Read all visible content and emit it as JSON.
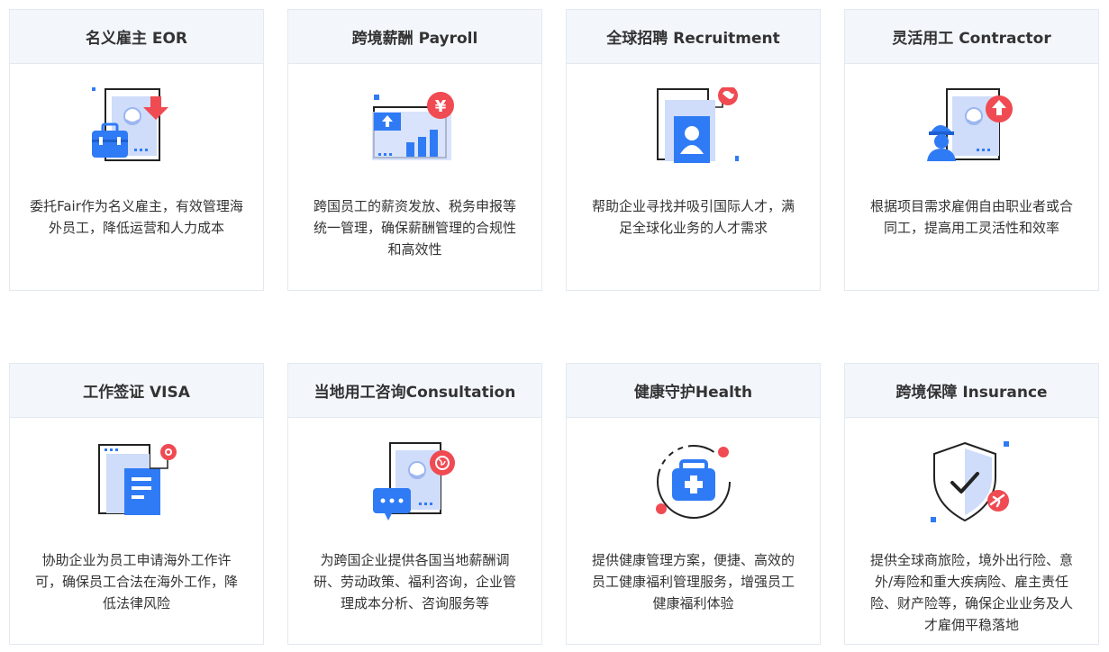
{
  "colors": {
    "blue": "#2f7bf5",
    "light_blue": "#cfdcfa",
    "red": "#f04a52",
    "dark": "#222222",
    "header_bg": "#f3f7fc",
    "border": "#e3e9f1"
  },
  "cards": [
    {
      "title": "名义雇主 EOR",
      "desc": "委托Fair作为名义雇主，有效管理海外员工，降低运营和人力成本",
      "icon": "eor-icon"
    },
    {
      "title": "跨境薪酬 Payroll",
      "desc": "跨国员工的薪资发放、税务申报等统一管理，确保薪酬管理的合规性和高效性",
      "icon": "payroll-icon"
    },
    {
      "title": "全球招聘 Recruitment",
      "desc": "帮助企业寻找并吸引国际人才，满足全球化业务的人才需求",
      "icon": "recruitment-icon"
    },
    {
      "title": "灵活用工 Contractor",
      "desc": "根据项目需求雇佣自由职业者或合同工，提高用工灵活性和效率",
      "icon": "contractor-icon"
    },
    {
      "title": "工作签证 VISA",
      "desc": "协助企业为员工申请海外工作许可，确保员工合法在海外工作，降低法律风险",
      "icon": "visa-icon"
    },
    {
      "title": "当地用工咨询Consultation",
      "desc": "为跨国企业提供各国当地薪酬调研、劳动政策、福利咨询，企业管理成本分析、咨询服务等",
      "icon": "consultation-icon"
    },
    {
      "title": "健康守护Health",
      "desc": "提供健康管理方案，便捷、高效的员工健康福利管理服务，增强员工健康福利体验",
      "icon": "health-icon"
    },
    {
      "title": "跨境保障 Insurance",
      "desc": "提供全球商旅险，境外出行险、意外/寿险和重大疾病险、雇主责任险、财产险等，确保企业业务及人才雇佣平稳落地",
      "icon": "insurance-icon"
    }
  ]
}
